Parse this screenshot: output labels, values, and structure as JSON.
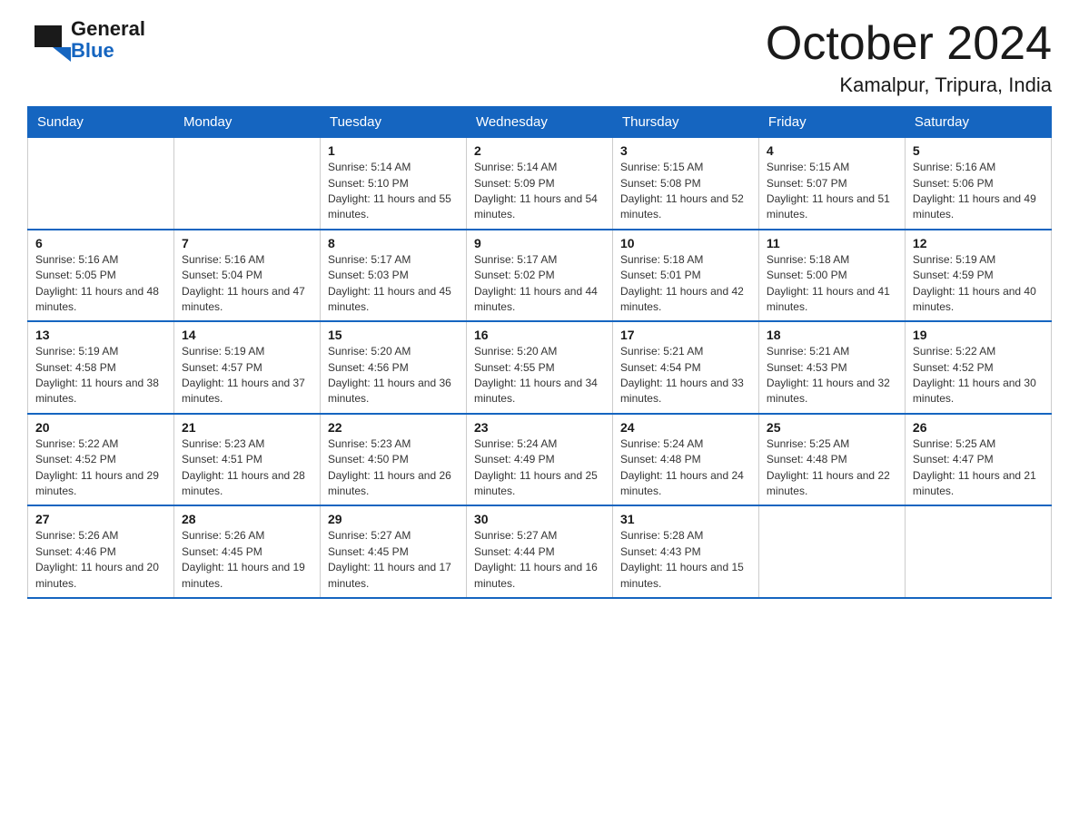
{
  "header": {
    "logo_general": "General",
    "logo_blue": "Blue",
    "month_title": "October 2024",
    "location": "Kamalpur, Tripura, India"
  },
  "weekdays": [
    "Sunday",
    "Monday",
    "Tuesday",
    "Wednesday",
    "Thursday",
    "Friday",
    "Saturday"
  ],
  "weeks": [
    [
      {
        "day": "",
        "sunrise": "",
        "sunset": "",
        "daylight": ""
      },
      {
        "day": "",
        "sunrise": "",
        "sunset": "",
        "daylight": ""
      },
      {
        "day": "1",
        "sunrise": "5:14 AM",
        "sunset": "5:10 PM",
        "daylight": "11 hours and 55 minutes."
      },
      {
        "day": "2",
        "sunrise": "5:14 AM",
        "sunset": "5:09 PM",
        "daylight": "11 hours and 54 minutes."
      },
      {
        "day": "3",
        "sunrise": "5:15 AM",
        "sunset": "5:08 PM",
        "daylight": "11 hours and 52 minutes."
      },
      {
        "day": "4",
        "sunrise": "5:15 AM",
        "sunset": "5:07 PM",
        "daylight": "11 hours and 51 minutes."
      },
      {
        "day": "5",
        "sunrise": "5:16 AM",
        "sunset": "5:06 PM",
        "daylight": "11 hours and 49 minutes."
      }
    ],
    [
      {
        "day": "6",
        "sunrise": "5:16 AM",
        "sunset": "5:05 PM",
        "daylight": "11 hours and 48 minutes."
      },
      {
        "day": "7",
        "sunrise": "5:16 AM",
        "sunset": "5:04 PM",
        "daylight": "11 hours and 47 minutes."
      },
      {
        "day": "8",
        "sunrise": "5:17 AM",
        "sunset": "5:03 PM",
        "daylight": "11 hours and 45 minutes."
      },
      {
        "day": "9",
        "sunrise": "5:17 AM",
        "sunset": "5:02 PM",
        "daylight": "11 hours and 44 minutes."
      },
      {
        "day": "10",
        "sunrise": "5:18 AM",
        "sunset": "5:01 PM",
        "daylight": "11 hours and 42 minutes."
      },
      {
        "day": "11",
        "sunrise": "5:18 AM",
        "sunset": "5:00 PM",
        "daylight": "11 hours and 41 minutes."
      },
      {
        "day": "12",
        "sunrise": "5:19 AM",
        "sunset": "4:59 PM",
        "daylight": "11 hours and 40 minutes."
      }
    ],
    [
      {
        "day": "13",
        "sunrise": "5:19 AM",
        "sunset": "4:58 PM",
        "daylight": "11 hours and 38 minutes."
      },
      {
        "day": "14",
        "sunrise": "5:19 AM",
        "sunset": "4:57 PM",
        "daylight": "11 hours and 37 minutes."
      },
      {
        "day": "15",
        "sunrise": "5:20 AM",
        "sunset": "4:56 PM",
        "daylight": "11 hours and 36 minutes."
      },
      {
        "day": "16",
        "sunrise": "5:20 AM",
        "sunset": "4:55 PM",
        "daylight": "11 hours and 34 minutes."
      },
      {
        "day": "17",
        "sunrise": "5:21 AM",
        "sunset": "4:54 PM",
        "daylight": "11 hours and 33 minutes."
      },
      {
        "day": "18",
        "sunrise": "5:21 AM",
        "sunset": "4:53 PM",
        "daylight": "11 hours and 32 minutes."
      },
      {
        "day": "19",
        "sunrise": "5:22 AM",
        "sunset": "4:52 PM",
        "daylight": "11 hours and 30 minutes."
      }
    ],
    [
      {
        "day": "20",
        "sunrise": "5:22 AM",
        "sunset": "4:52 PM",
        "daylight": "11 hours and 29 minutes."
      },
      {
        "day": "21",
        "sunrise": "5:23 AM",
        "sunset": "4:51 PM",
        "daylight": "11 hours and 28 minutes."
      },
      {
        "day": "22",
        "sunrise": "5:23 AM",
        "sunset": "4:50 PM",
        "daylight": "11 hours and 26 minutes."
      },
      {
        "day": "23",
        "sunrise": "5:24 AM",
        "sunset": "4:49 PM",
        "daylight": "11 hours and 25 minutes."
      },
      {
        "day": "24",
        "sunrise": "5:24 AM",
        "sunset": "4:48 PM",
        "daylight": "11 hours and 24 minutes."
      },
      {
        "day": "25",
        "sunrise": "5:25 AM",
        "sunset": "4:48 PM",
        "daylight": "11 hours and 22 minutes."
      },
      {
        "day": "26",
        "sunrise": "5:25 AM",
        "sunset": "4:47 PM",
        "daylight": "11 hours and 21 minutes."
      }
    ],
    [
      {
        "day": "27",
        "sunrise": "5:26 AM",
        "sunset": "4:46 PM",
        "daylight": "11 hours and 20 minutes."
      },
      {
        "day": "28",
        "sunrise": "5:26 AM",
        "sunset": "4:45 PM",
        "daylight": "11 hours and 19 minutes."
      },
      {
        "day": "29",
        "sunrise": "5:27 AM",
        "sunset": "4:45 PM",
        "daylight": "11 hours and 17 minutes."
      },
      {
        "day": "30",
        "sunrise": "5:27 AM",
        "sunset": "4:44 PM",
        "daylight": "11 hours and 16 minutes."
      },
      {
        "day": "31",
        "sunrise": "5:28 AM",
        "sunset": "4:43 PM",
        "daylight": "11 hours and 15 minutes."
      },
      {
        "day": "",
        "sunrise": "",
        "sunset": "",
        "daylight": ""
      },
      {
        "day": "",
        "sunrise": "",
        "sunset": "",
        "daylight": ""
      }
    ]
  ]
}
